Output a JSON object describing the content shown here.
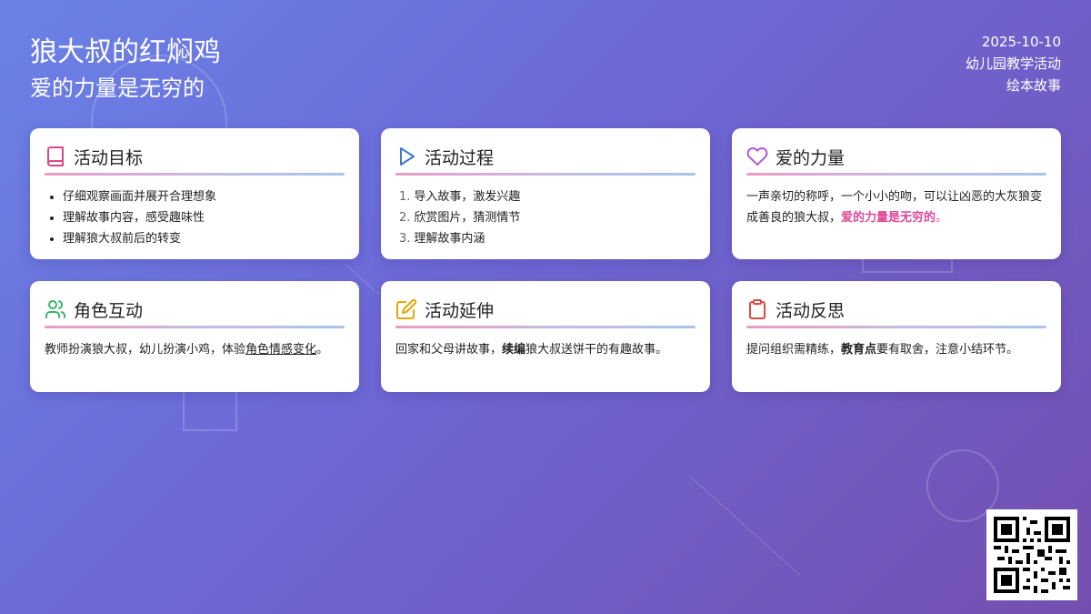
{
  "header": {
    "title": "狼大叔的红焖鸡",
    "subtitle": "爱的力量是无穷的"
  },
  "meta": {
    "date": "2025-10-10",
    "category": "幼儿园教学活动",
    "type": "绘本故事"
  },
  "cards": {
    "goals": {
      "title": "活动目标",
      "icon": "book-icon",
      "items": [
        "仔细观察画面并展开合理想象",
        "理解故事内容，感受趣味性",
        "理解狼大叔前后的转变"
      ]
    },
    "process": {
      "title": "活动过程",
      "icon": "play-icon",
      "items": [
        {
          "num": "1.",
          "text": "导入故事，激发兴趣"
        },
        {
          "num": "2.",
          "text": "欣赏图片，猜测情节"
        },
        {
          "num": "3.",
          "text": "理解故事内涵"
        }
      ]
    },
    "love": {
      "title": "爱的力量",
      "icon": "heart-icon",
      "text_before": "一声亲切的称呼，一个小小的吻，可以让凶恶的大灰狼变成善良的狼大叔，",
      "highlight": "爱的力量是无穷的",
      "text_after": "。"
    },
    "roles": {
      "title": "角色互动",
      "icon": "users-icon",
      "text_before": "教师扮演狼大叔，幼儿扮演小鸡，体验",
      "underline": "角色情感变化",
      "text_after": "。"
    },
    "extension": {
      "title": "活动延伸",
      "icon": "edit-icon",
      "text_before": "回家和父母讲故事，",
      "bold": "续编",
      "text_after": "狼大叔送饼干的有趣故事。"
    },
    "reflection": {
      "title": "活动反思",
      "icon": "clipboard-icon",
      "text_before": "提问组织需精练，",
      "bold": "教育点",
      "text_after": "要有取舍，注意小结环节。"
    }
  },
  "colors": {
    "accent_pink": "#e0479a",
    "book": "#d9488f",
    "play": "#3a7bd5",
    "heart": "#b35ad6",
    "users": "#3bb36a",
    "edit": "#e0a800",
    "clipboard": "#e04848"
  },
  "qr": {
    "icon": "qr-code-icon"
  }
}
